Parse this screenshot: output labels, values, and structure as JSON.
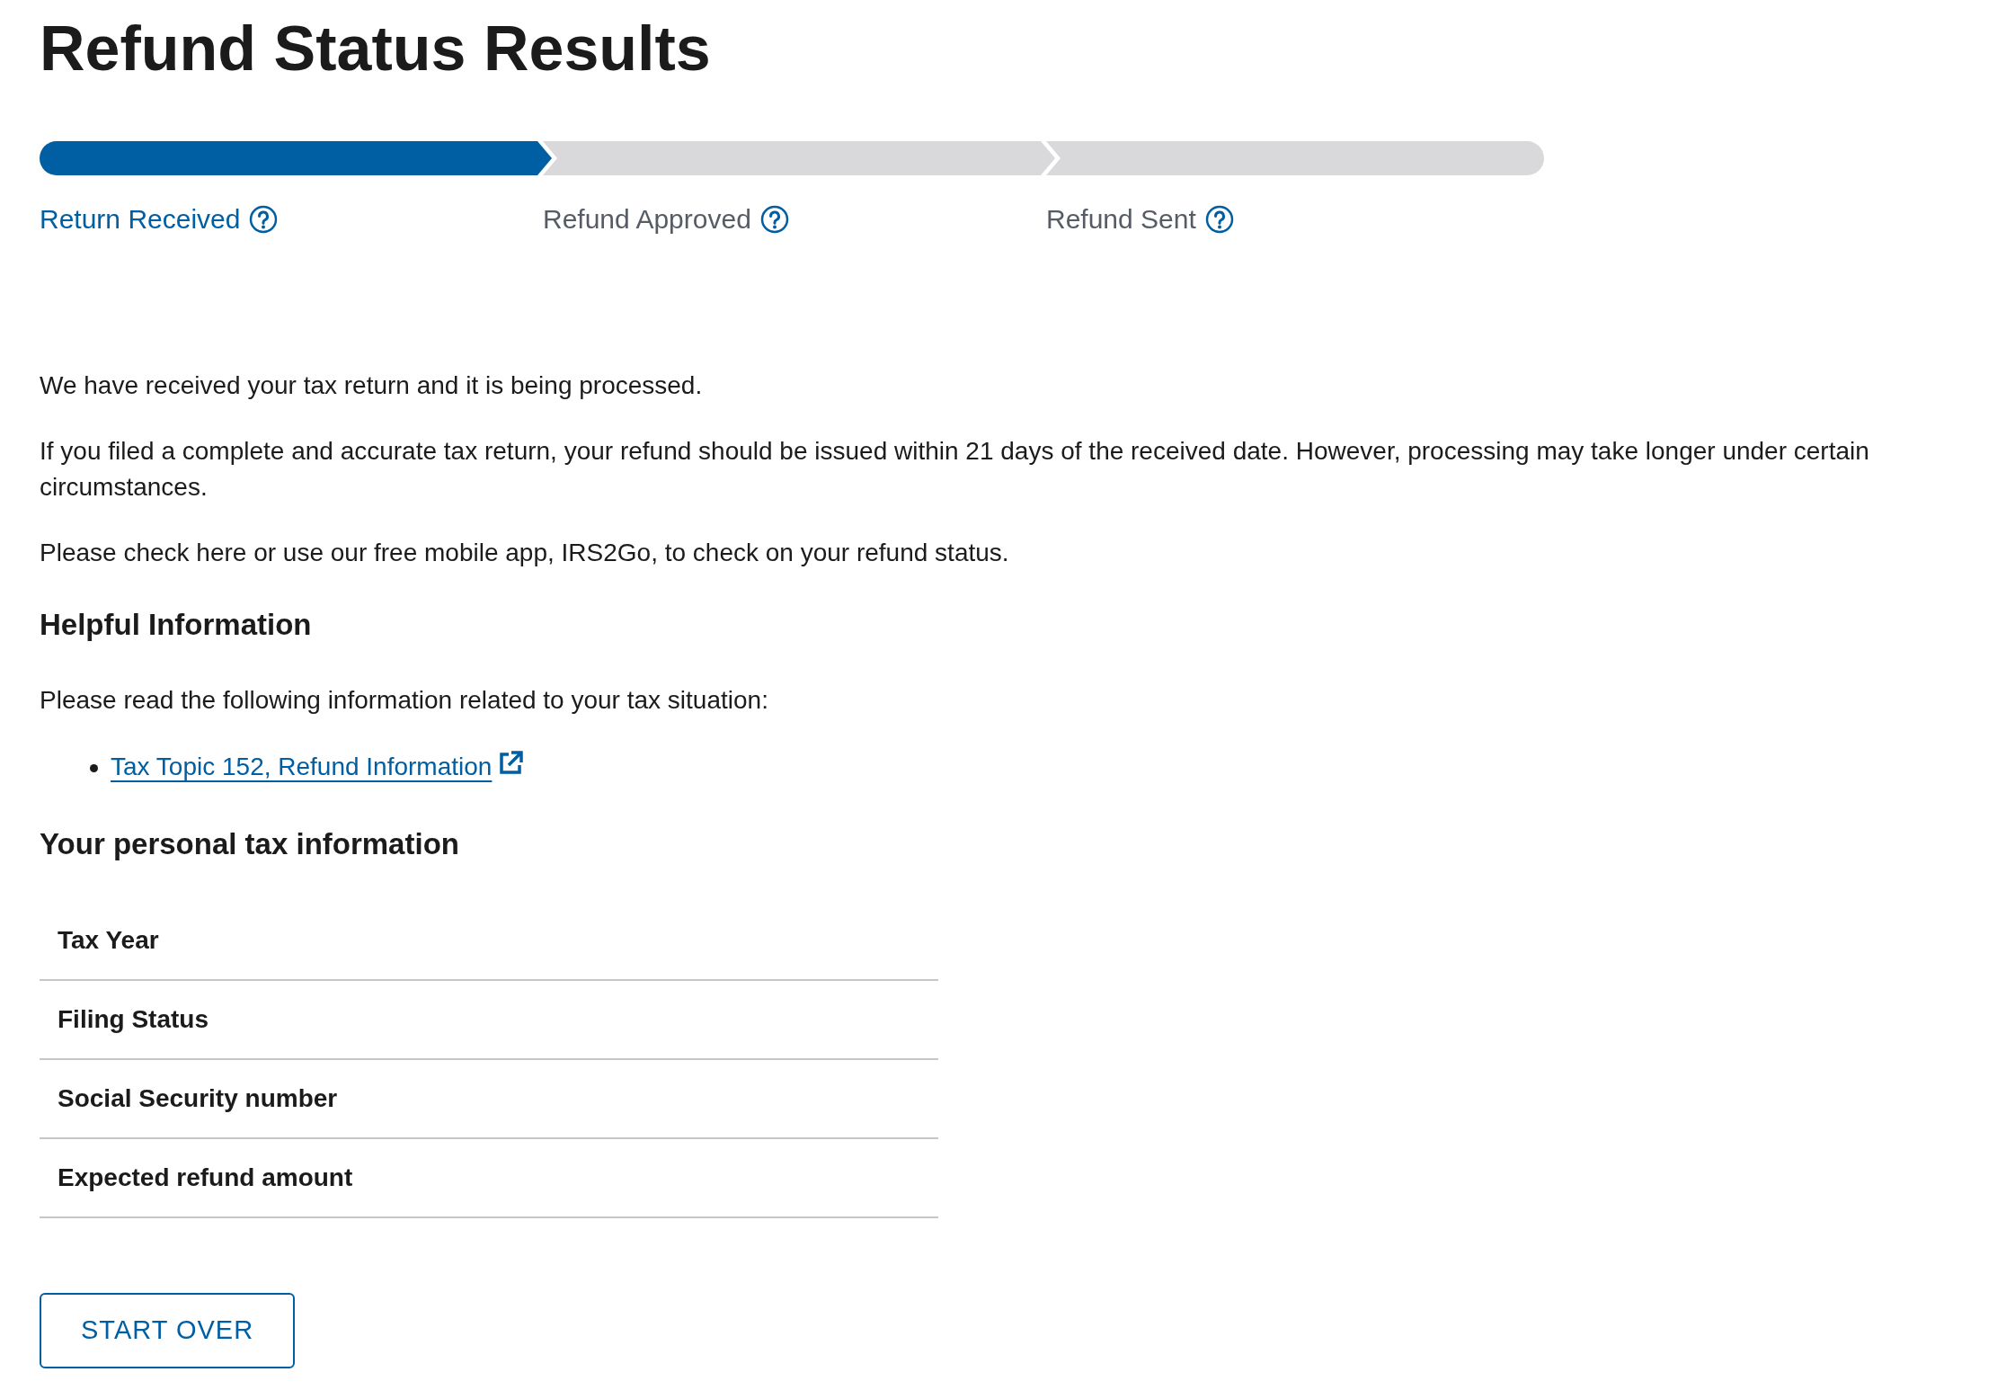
{
  "title": "Refund Status Results",
  "steps": [
    {
      "label": "Return Received",
      "completed": true
    },
    {
      "label": "Refund Approved",
      "completed": false
    },
    {
      "label": "Refund Sent",
      "completed": false
    }
  ],
  "messages": [
    "We have received your tax return and it is being processed.",
    "If you filed a complete and accurate tax return, your refund should be issued within 21 days of the received date. However, processing may take longer under certain circumstances.",
    "Please check here or use our free mobile app, IRS2Go, to check on your refund status."
  ],
  "helpful": {
    "heading": "Helpful Information",
    "intro": "Please read the following information related to your tax situation:",
    "links": [
      "Tax Topic 152, Refund Information"
    ]
  },
  "personal": {
    "heading": "Your personal tax information",
    "rows": [
      "Tax Year",
      "Filing Status",
      "Social Security number",
      "Expected refund amount"
    ]
  },
  "button": "START OVER"
}
